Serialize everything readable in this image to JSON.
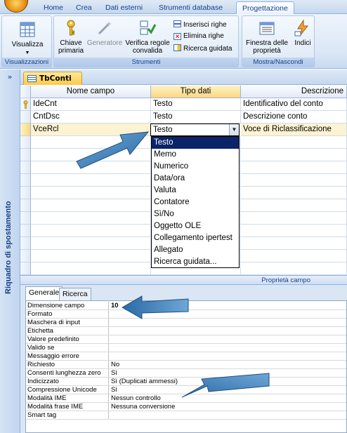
{
  "ribbon_tabs": [
    {
      "label": "Home"
    },
    {
      "label": "Crea"
    },
    {
      "label": "Dati esterni"
    },
    {
      "label": "Strumenti database"
    },
    {
      "label": "Progettazione"
    }
  ],
  "ribbon": {
    "groups": {
      "visualizzazioni": "Visualizzazioni",
      "strumenti": "Strumenti",
      "mostra": "Mostra/Nascondi"
    },
    "buttons": {
      "visualizza": "Visualizza",
      "chiave_line1": "Chiave",
      "chiave_line2": "primaria",
      "generatore": "Generatore",
      "verifica_line1": "Verifica regole",
      "verifica_line2": "convalida",
      "inserisci_righe": "Inserisci righe",
      "elimina_righe": "Elimina righe",
      "ricerca_guidata": "Ricerca guidata",
      "finestra_line1": "Finestra delle",
      "finestra_line2": "proprietà",
      "indici": "Indici"
    }
  },
  "nav_pane": {
    "collapse": "»",
    "title": "Riquadro di spostamento"
  },
  "document": {
    "tab_label": "TbConti"
  },
  "grid": {
    "headers": {
      "nome_campo": "Nome campo",
      "tipo_dati": "Tipo dati",
      "descrizione": "Descrizione"
    },
    "rows": [
      {
        "name": "IdeCnt",
        "type": "Testo",
        "desc": "Identificativo del conto"
      },
      {
        "name": "CntDsc",
        "type": "Testo",
        "desc": "Descrizione conto"
      },
      {
        "name": "VceRcl",
        "type": "Testo",
        "desc": "Voce di Riclassificazione"
      }
    ]
  },
  "dropdown": {
    "selected": "Testo",
    "options": [
      "Testo",
      "Memo",
      "Numerico",
      "Data/ora",
      "Valuta",
      "Contatore",
      "Sì/No",
      "Oggetto OLE",
      "Collegamento ipertest",
      "Allegato",
      "Ricerca guidata..."
    ]
  },
  "properties": {
    "title": "Proprietà campo",
    "tabs": {
      "generale": "Generale",
      "ricerca": "Ricerca"
    },
    "rows": [
      {
        "label": "Dimensione campo",
        "value": "10"
      },
      {
        "label": "Formato",
        "value": ""
      },
      {
        "label": "Maschera di input",
        "value": ""
      },
      {
        "label": "Etichetta",
        "value": ""
      },
      {
        "label": "Valore predefinito",
        "value": ""
      },
      {
        "label": "Valido se",
        "value": ""
      },
      {
        "label": "Messaggio errore",
        "value": ""
      },
      {
        "label": "Richiesto",
        "value": "No"
      },
      {
        "label": "Consenti lunghezza zero",
        "value": "Sì"
      },
      {
        "label": "Indicizzato",
        "value": "Sì (Duplicati ammessi)"
      },
      {
        "label": "Compressione Unicode",
        "value": "Sì"
      },
      {
        "label": "Modalità IME",
        "value": "Nessun controllo"
      },
      {
        "label": "Modalità frase IME",
        "value": "Nessuna conversione"
      },
      {
        "label": "Smart tag",
        "value": ""
      }
    ]
  },
  "colors": {
    "arrow": "#3b80b8",
    "highlight": "#0a246a",
    "ribbon_text": "#15428b"
  }
}
